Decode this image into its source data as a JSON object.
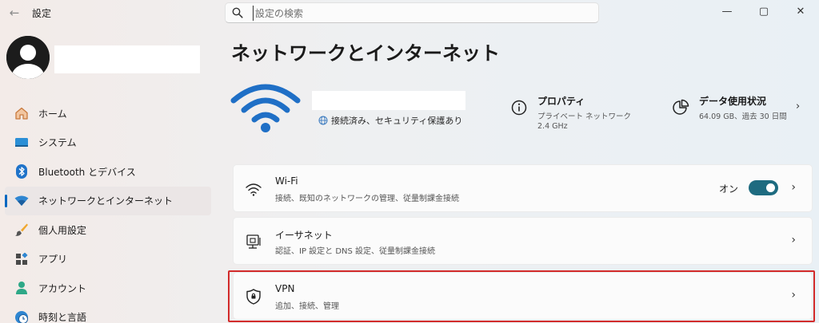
{
  "window": {
    "title": "設定",
    "controls": [
      "—",
      "▢",
      "✕"
    ]
  },
  "search": {
    "placeholder": "設定の検索"
  },
  "sidebar": {
    "items": [
      {
        "label": "ホーム",
        "icon": "home-icon"
      },
      {
        "label": "システム",
        "icon": "system-icon"
      },
      {
        "label": "Bluetooth とデバイス",
        "icon": "bluetooth-icon"
      },
      {
        "label": "ネットワークとインターネット",
        "icon": "network-icon",
        "active": true
      },
      {
        "label": "個人用設定",
        "icon": "brush-icon"
      },
      {
        "label": "アプリ",
        "icon": "apps-icon"
      },
      {
        "label": "アカウント",
        "icon": "account-icon"
      },
      {
        "label": "時刻と言語",
        "icon": "clock-globe-icon"
      }
    ]
  },
  "main": {
    "title": "ネットワークとインターネット",
    "connection": {
      "status": "接続済み、セキュリティ保護あり"
    },
    "properties": {
      "title": "プロパティ",
      "line1": "プライベート ネットワーク",
      "line2": "2.4 GHz"
    },
    "data_usage": {
      "title": "データ使用状況",
      "line1": "64.09 GB、過去 30 日間"
    },
    "cards": [
      {
        "title": "Wi-Fi",
        "desc": "接続、既知のネットワークの管理、従量制課金接続",
        "icon": "wifi-icon",
        "toggle_label": "オン",
        "toggle_on": true
      },
      {
        "title": "イーサネット",
        "desc": "認証、IP 設定と DNS 設定、従量制課金接続",
        "icon": "ethernet-icon"
      },
      {
        "title": "VPN",
        "desc": "追加、接続、管理",
        "icon": "shield-icon"
      }
    ]
  },
  "colors": {
    "accent": "#0067c0",
    "toggle": "#1e6b80",
    "highlight": "#d22a2a"
  }
}
